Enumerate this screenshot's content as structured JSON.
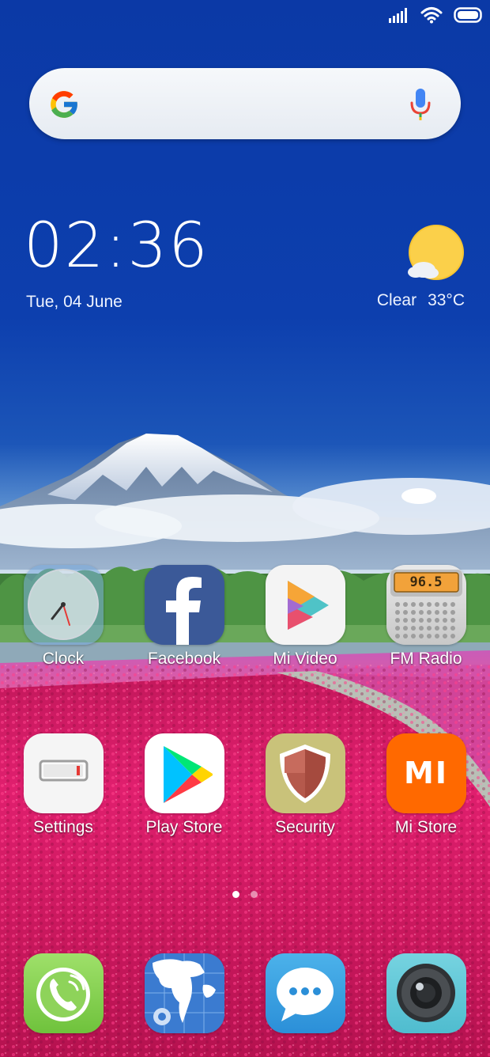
{
  "status_bar": {
    "signal_icon": "cellular-signal-icon",
    "wifi_icon": "wifi-icon",
    "battery_icon": "battery-icon"
  },
  "search_bar": {
    "logo_icon": "google-g-icon",
    "mic_icon": "microphone-icon"
  },
  "clock_widget": {
    "time": "02:36",
    "date": "Tue, 04 June"
  },
  "weather_widget": {
    "icon": "sun-cloud-icon",
    "condition": "Clear",
    "temperature": "33°C"
  },
  "apps": [
    {
      "label": "Clock",
      "icon": "clock-icon"
    },
    {
      "label": "Facebook",
      "icon": "facebook-icon"
    },
    {
      "label": "Mi Video",
      "icon": "mi-video-icon"
    },
    {
      "label": "FM Radio",
      "icon": "fm-radio-icon",
      "display": "96.5"
    },
    {
      "label": "Settings",
      "icon": "settings-icon"
    },
    {
      "label": "Play Store",
      "icon": "play-store-icon"
    },
    {
      "label": "Security",
      "icon": "security-shield-icon"
    },
    {
      "label": "Mi Store",
      "icon": "mi-store-icon",
      "logo_text": "MI"
    }
  ],
  "page_indicator": {
    "pages": 2,
    "active": 1
  },
  "dock": [
    {
      "icon": "phone-icon"
    },
    {
      "icon": "browser-globe-icon"
    },
    {
      "icon": "messaging-icon"
    },
    {
      "icon": "camera-icon"
    }
  ],
  "colors": {
    "sky": "#0b39a6",
    "mi_orange": "#ff6900",
    "facebook_blue": "#3b5998",
    "flower_pink": "#d81b66"
  }
}
